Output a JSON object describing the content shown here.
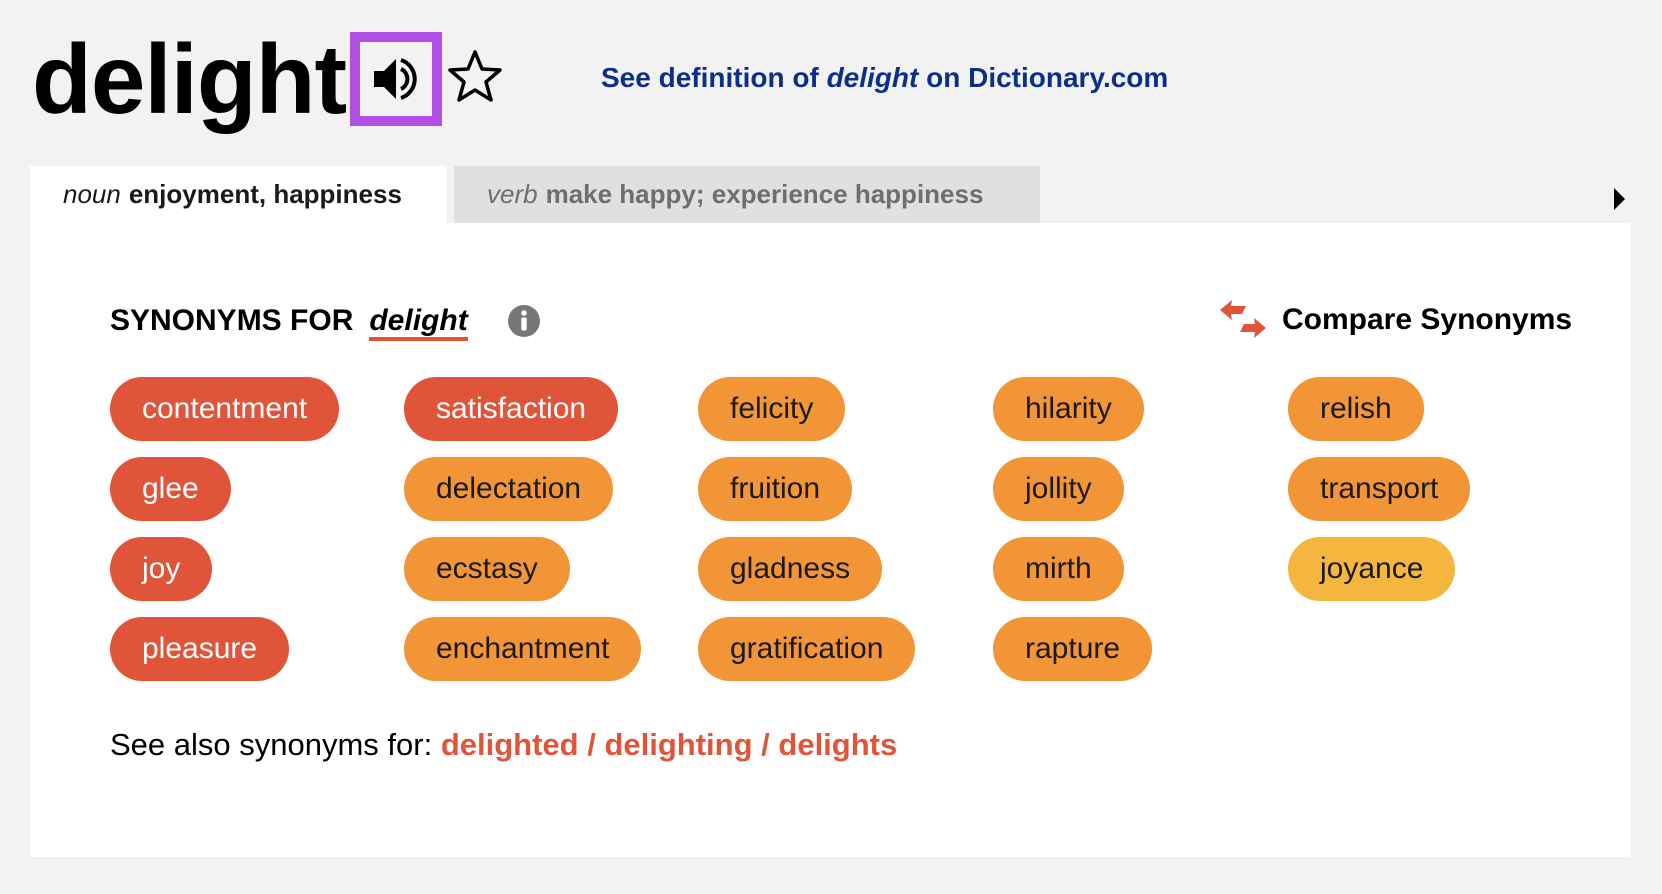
{
  "header": {
    "headword": "delight",
    "audio_icon": "speaker-icon",
    "favorite_icon": "star-outline-icon",
    "dictionary_link": {
      "prefix": "See definition of ",
      "word": "delight",
      "suffix": " on Dictionary.com"
    }
  },
  "tabs": [
    {
      "pos": "noun",
      "label": "enjoyment, happiness",
      "active": true
    },
    {
      "pos": "verb",
      "label": "make happy; experience happiness",
      "active": false
    }
  ],
  "tabs_next_icon": "triangle-right-icon",
  "synonyms": {
    "heading": "SYNONYMS FOR",
    "word": "delight",
    "info_icon": "info-icon",
    "compare_label": "Compare Synonyms",
    "compare_icon": "swap-arrows-icon",
    "colors": {
      "strongest": "#e0553a",
      "strong": "#f19537",
      "weak": "#f4b63e",
      "text_light": "#ffffff",
      "text_dark": "#1a1a1a"
    },
    "columns": [
      [
        {
          "word": "contentment",
          "relevance": "strongest"
        },
        {
          "word": "glee",
          "relevance": "strongest"
        },
        {
          "word": "joy",
          "relevance": "strongest"
        },
        {
          "word": "pleasure",
          "relevance": "strongest"
        }
      ],
      [
        {
          "word": "satisfaction",
          "relevance": "strongest"
        },
        {
          "word": "delectation",
          "relevance": "strong"
        },
        {
          "word": "ecstasy",
          "relevance": "strong"
        },
        {
          "word": "enchantment",
          "relevance": "strong"
        }
      ],
      [
        {
          "word": "felicity",
          "relevance": "strong"
        },
        {
          "word": "fruition",
          "relevance": "strong"
        },
        {
          "word": "gladness",
          "relevance": "strong"
        },
        {
          "word": "gratification",
          "relevance": "strong"
        }
      ],
      [
        {
          "word": "hilarity",
          "relevance": "strong"
        },
        {
          "word": "jollity",
          "relevance": "strong"
        },
        {
          "word": "mirth",
          "relevance": "strong"
        },
        {
          "word": "rapture",
          "relevance": "strong"
        }
      ],
      [
        {
          "word": "relish",
          "relevance": "strong"
        },
        {
          "word": "transport",
          "relevance": "strong"
        },
        {
          "word": "joyance",
          "relevance": "weak"
        }
      ]
    ]
  },
  "see_also": {
    "label": "See also synonyms for: ",
    "links": [
      "delighted",
      "delighting",
      "delights"
    ],
    "separator": " / "
  }
}
